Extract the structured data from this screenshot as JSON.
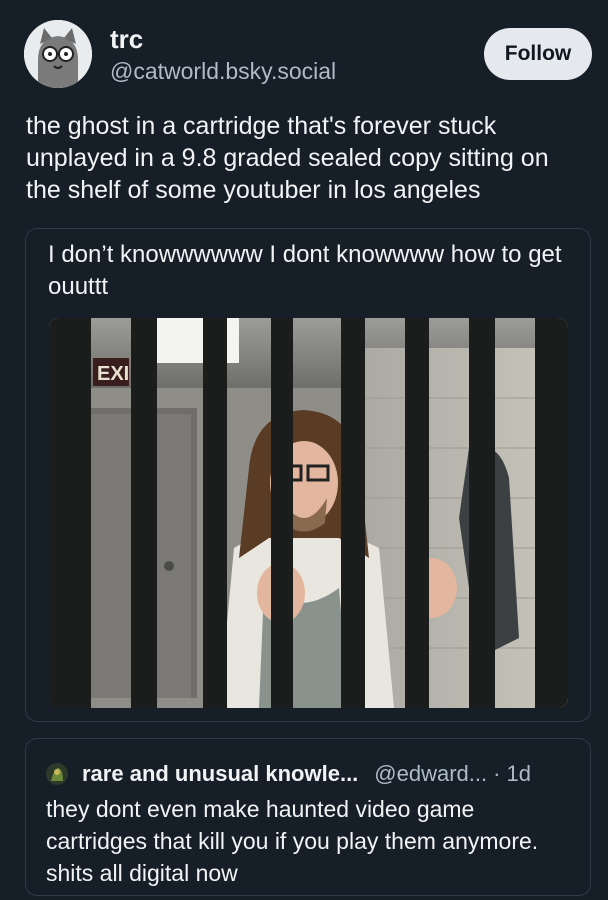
{
  "post": {
    "author": {
      "display_name": "trc",
      "handle": "@catworld.bsky.social",
      "avatar_icon": "cat-glasses-avatar-icon"
    },
    "follow_label": "Follow",
    "text": "the ghost in a cartridge that's forever stuck unplayed in a 9.8 graded sealed copy sitting on the shelf of some youtuber in los angeles"
  },
  "embed": {
    "text": "I don’t knowwwwww I dont knowwww how to get ouuttt",
    "image": {
      "description_icon": "man-behind-bars-photo",
      "exit_sign_text": "EXI"
    }
  },
  "quote": {
    "avatar_icon": "quote-author-avatar-icon",
    "display_name": "rare and unusual knowle...",
    "handle": "@edward...",
    "separator": "·",
    "time": "1d",
    "text": "they dont even make haunted video game cartridges that kill you if you play them anymore. shits all digital now"
  },
  "colors": {
    "background": "#161e27",
    "border": "#2e3b49",
    "secondary_text": "#aebbc9",
    "follow_bg": "#e5e8ec"
  }
}
